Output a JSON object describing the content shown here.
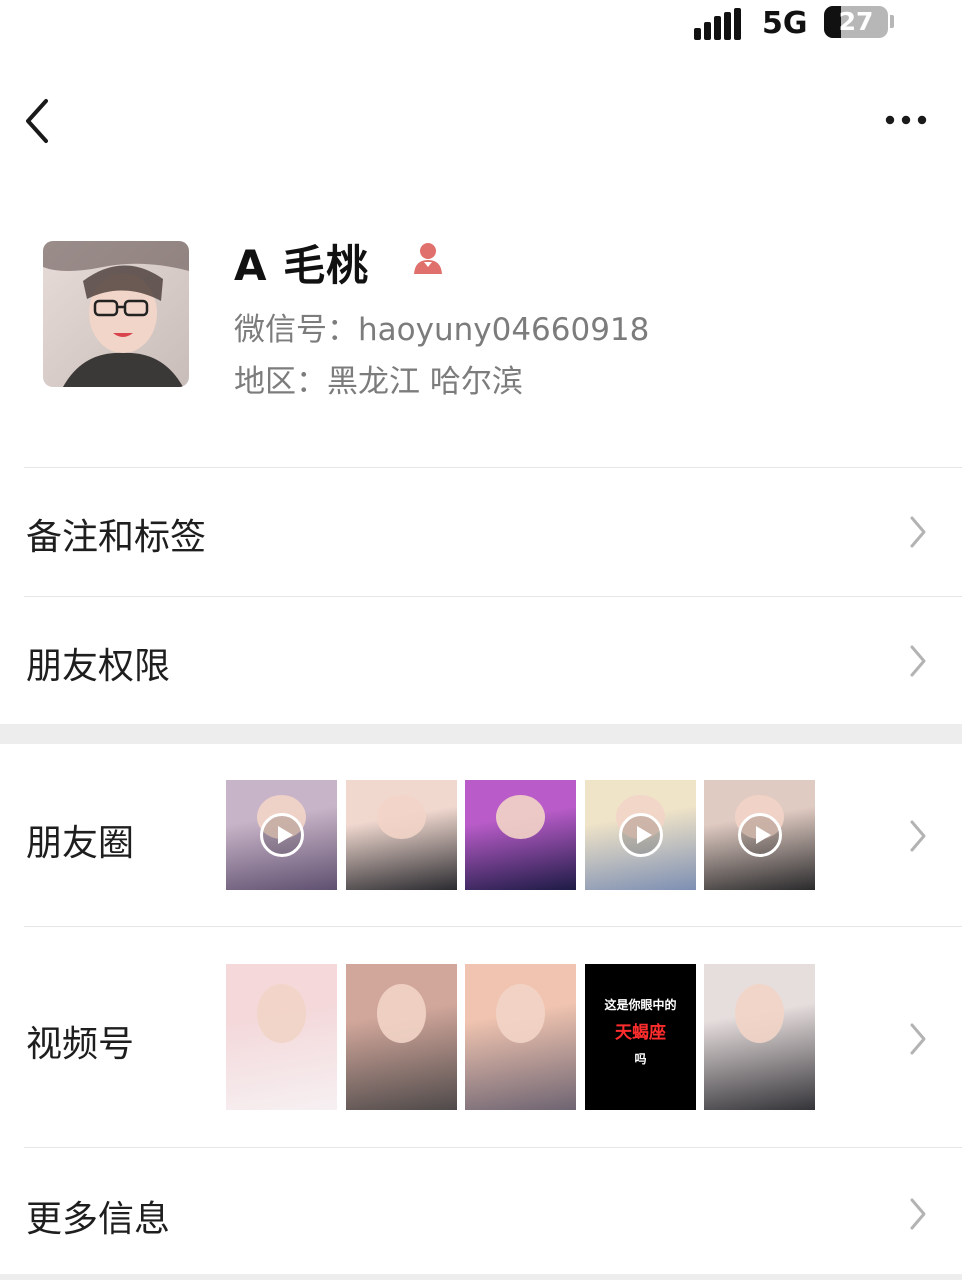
{
  "status_bar": {
    "network": "5G",
    "battery_level": "27",
    "battery_fraction": 0.27
  },
  "nav": {
    "back_icon": "chevron-left-icon",
    "more_icon": "more-dots-icon"
  },
  "profile": {
    "name": "A 毛桃",
    "gender_icon": "female-icon",
    "wechat_id": "微信号：haoyuny04660918",
    "region": "地区：黑龙江 哈尔滨"
  },
  "menu": {
    "notes_tags": "备注和标签",
    "friend_permissions": "朋友权限",
    "moments": "朋友圈",
    "channels": "视频号",
    "more_info": "更多信息"
  },
  "moments_thumbs": [
    {
      "is_video": true,
      "colors": [
        "#c8b4c8",
        "#5f5070"
      ]
    },
    {
      "is_video": false,
      "colors": [
        "#f0d8cf",
        "#2b2b30"
      ]
    },
    {
      "is_video": false,
      "colors": [
        "#b95cc9",
        "#1d1b45"
      ]
    },
    {
      "is_video": true,
      "colors": [
        "#efe3c8",
        "#7d8fb3"
      ]
    },
    {
      "is_video": true,
      "colors": [
        "#e0cbc2",
        "#2a2a2c"
      ]
    }
  ],
  "channels_thumbs": [
    {
      "colors": [
        "#f4d8da",
        "#f6f0f2"
      ]
    },
    {
      "colors": [
        "#d2a79b",
        "#4f4a4a"
      ]
    },
    {
      "colors": [
        "#f0c4b0",
        "#6e6472"
      ]
    },
    {
      "colors": [
        "#000000",
        "#000000"
      ],
      "lines": [
        "这是你眼中的",
        "天蝎座",
        "吗"
      ]
    },
    {
      "colors": [
        "#e6dddd",
        "#343438"
      ]
    }
  ],
  "colors": {
    "accent_female": "#e0706b",
    "divider": "#e6e6e6",
    "section_gap": "#ededed"
  }
}
